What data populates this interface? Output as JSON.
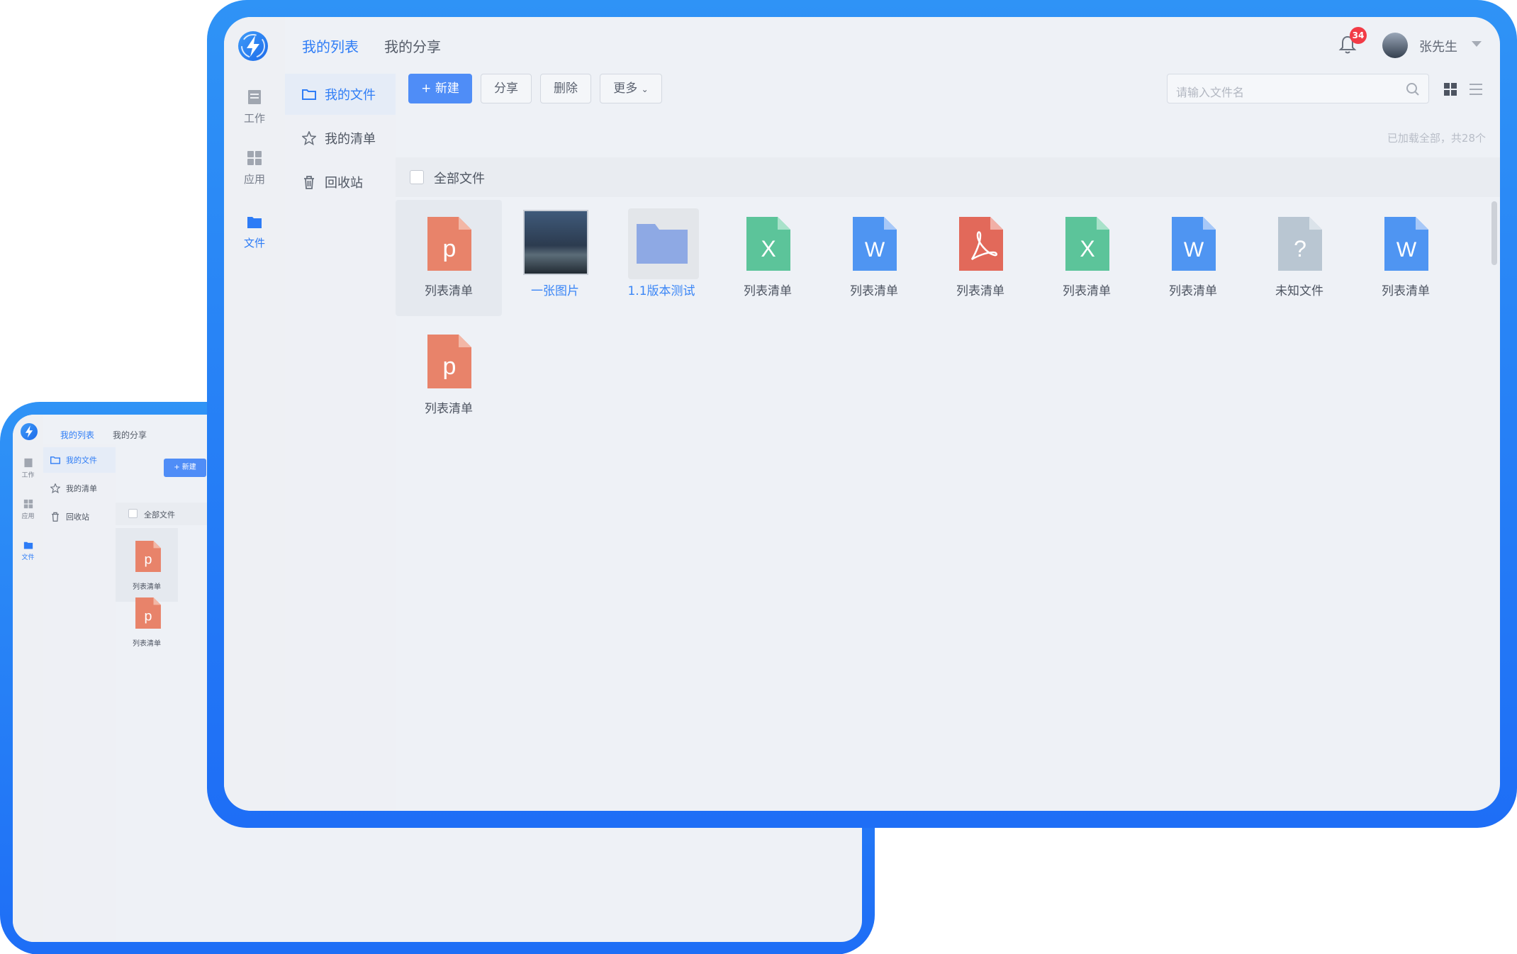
{
  "header": {
    "tabs": [
      {
        "label": "我的列表",
        "active": true
      },
      {
        "label": "我的分享",
        "active": false
      }
    ],
    "notification_count": "34",
    "username": "张先生"
  },
  "rail": [
    {
      "label": "工作",
      "icon": "work-icon",
      "active": false
    },
    {
      "label": "应用",
      "icon": "apps-icon",
      "active": false
    },
    {
      "label": "文件",
      "icon": "folder-icon",
      "active": true
    }
  ],
  "sidebar": [
    {
      "label": "我的文件",
      "icon": "folder-outline-icon",
      "active": true
    },
    {
      "label": "我的清单",
      "icon": "star-icon",
      "active": false
    },
    {
      "label": "回收站",
      "icon": "trash-icon",
      "active": false
    }
  ],
  "toolbar": {
    "new_label": "+ 新建",
    "share_label": "分享",
    "delete_label": "删除",
    "more_label": "更多",
    "search_placeholder": "请输入文件名"
  },
  "status": {
    "loaded_text": "已加载全部，共28个"
  },
  "select_all_label": "全部文件",
  "files": [
    {
      "name": "列表清单",
      "type": "ppt",
      "selected": true
    },
    {
      "name": "一张图片",
      "type": "image",
      "link": true
    },
    {
      "name": "1.1版本测试",
      "type": "folder",
      "link": true
    },
    {
      "name": "列表清单",
      "type": "excel"
    },
    {
      "name": "列表清单",
      "type": "word"
    },
    {
      "name": "列表清单",
      "type": "pdf"
    },
    {
      "name": "列表清单",
      "type": "excel"
    },
    {
      "name": "列表清单",
      "type": "word"
    },
    {
      "name": "未知文件",
      "type": "unknown"
    },
    {
      "name": "列表清单",
      "type": "word"
    },
    {
      "name": "列表清单",
      "type": "ppt"
    }
  ],
  "colors": {
    "accent": "#2f7df6",
    "ppt": "#e8836a",
    "excel": "#5cc49a",
    "word": "#4f95f2",
    "pdf": "#e2695a",
    "unknown": "#b9c6d2",
    "folder": "#8ea9e4",
    "badge": "#f23b46"
  },
  "back_screen": {
    "tabs": [
      "我的列表",
      "我的分享"
    ],
    "rail": [
      "工作",
      "应用",
      "文件"
    ],
    "sidebar": [
      "我的文件",
      "我的清单",
      "回收站"
    ],
    "new_label": "+ 新建",
    "select_all_label": "全部文件",
    "files": [
      "列表清单",
      "列表清单"
    ]
  }
}
